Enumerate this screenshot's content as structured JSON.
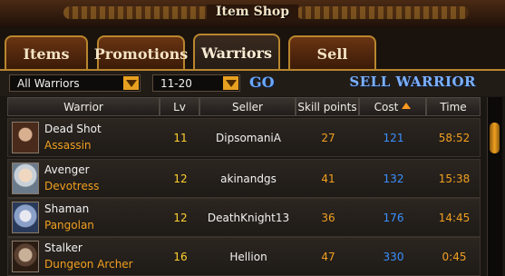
{
  "window": {
    "title": "Item Shop"
  },
  "tabs": [
    {
      "label": "Items"
    },
    {
      "label": "Promotions"
    },
    {
      "label": "Warriors"
    },
    {
      "label": "Sell"
    }
  ],
  "active_tab": "Warriors",
  "filters": {
    "type_select": "All Warriors",
    "level_select": "11-20",
    "go_label": "GO",
    "sell_label": "SELL WARRIOR"
  },
  "columns": {
    "warrior": "Warrior",
    "lv": "Lv",
    "seller": "Seller",
    "skill": "Skill points",
    "cost": "Cost",
    "time": "Time"
  },
  "sort": {
    "column": "Cost",
    "direction": "ascending",
    "icon": "sort-up-arrow-icon"
  },
  "rows": [
    {
      "name": "Dead Shot",
      "class": "Assassin",
      "lv": "11",
      "seller": "DipsomaniA",
      "skill": "27",
      "cost": "121",
      "time": "58:52"
    },
    {
      "name": "Avenger",
      "class": "Devotress",
      "lv": "12",
      "seller": "akinandgs",
      "skill": "41",
      "cost": "132",
      "time": "15:38"
    },
    {
      "name": "Shaman",
      "class": "Pangolan",
      "lv": "12",
      "seller": "DeathKnight13",
      "skill": "36",
      "cost": "176",
      "time": "14:45"
    },
    {
      "name": "Stalker",
      "class": "Dungeon Archer",
      "lv": "16",
      "seller": "Hellion",
      "skill": "47",
      "cost": "330",
      "time": "0:45"
    }
  ],
  "colors": {
    "accent_orange": "#f0a020",
    "level_yellow": "#ffd030",
    "cost_blue": "#3a90ff",
    "tab_border_gold": "#b8862e"
  }
}
